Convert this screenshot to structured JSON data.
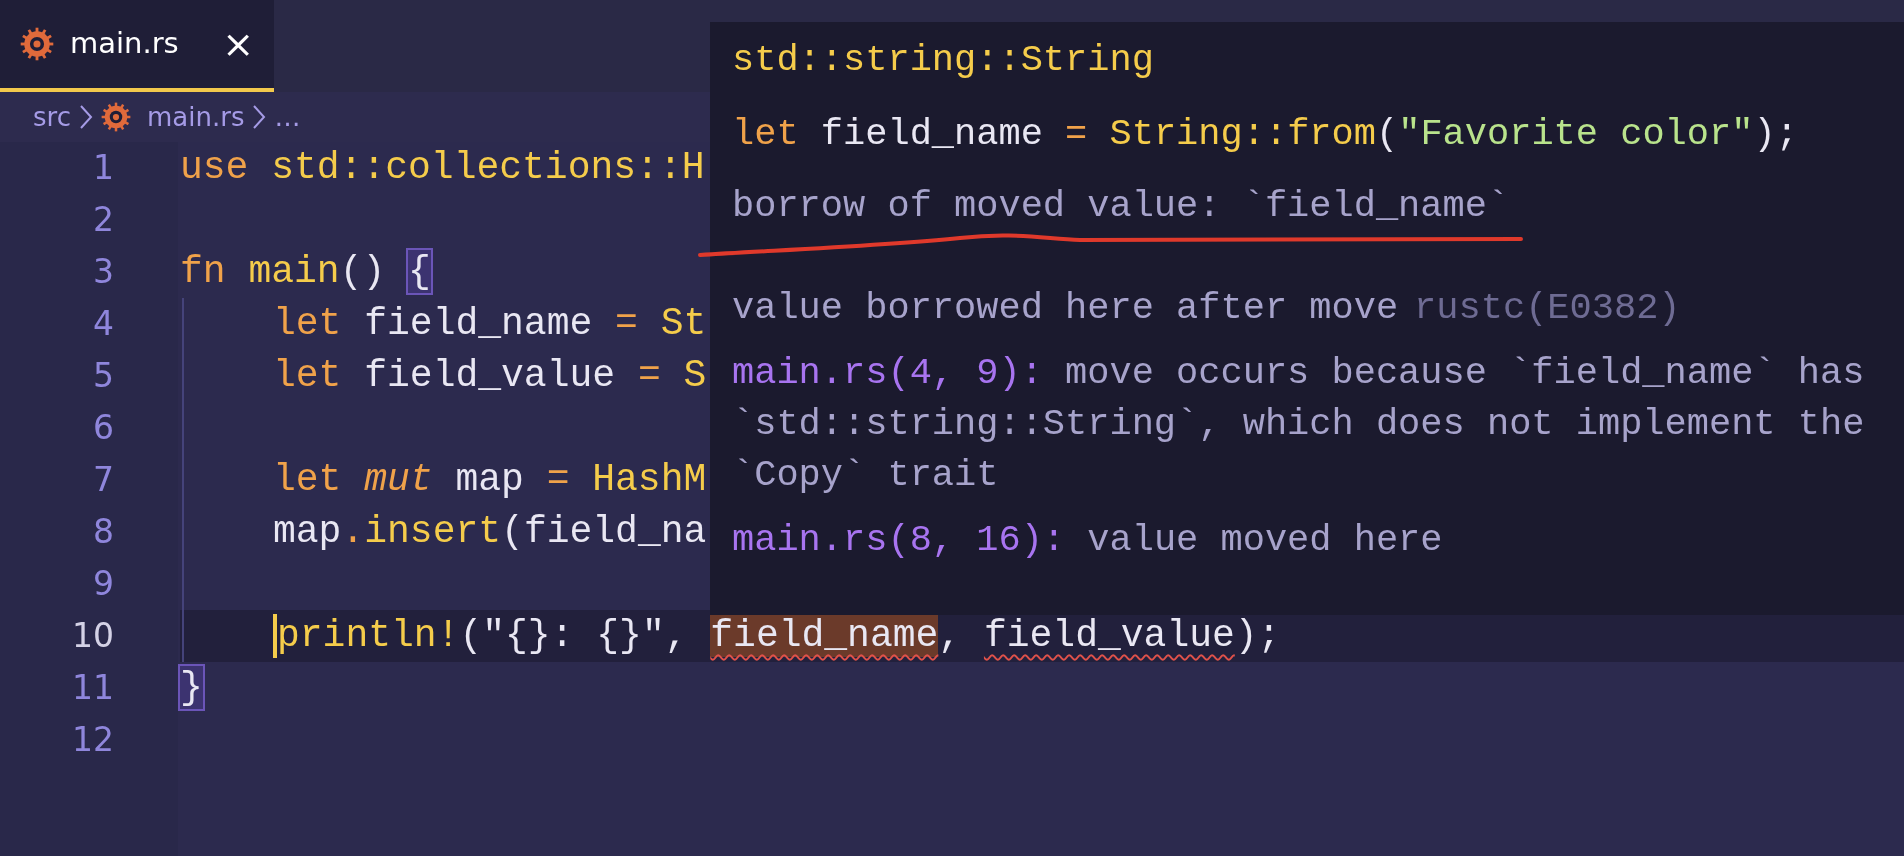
{
  "tabs": [
    {
      "label": "main.rs",
      "selected": true,
      "close": "×"
    }
  ],
  "breadcrumb": [
    {
      "label": "src",
      "icon": false
    },
    {
      "label": "main.rs",
      "icon": true
    },
    {
      "label": "…",
      "icon": false
    }
  ],
  "lines": [
    {
      "number": "1",
      "current": false,
      "indented": false,
      "tokens": [
        {
          "text": "use ",
          "kind": "keyword"
        },
        {
          "text": "std::collections::H",
          "kind": "type"
        }
      ]
    },
    {
      "number": "2",
      "current": false,
      "indented": false
    },
    {
      "number": "3",
      "current": false,
      "indented": false,
      "tokens": [
        {
          "text": "fn ",
          "kind": "keyword"
        },
        {
          "text": "main",
          "kind": "function"
        },
        {
          "text": "() ",
          "kind": "punct"
        },
        {
          "text": "{",
          "kind": "brace_match"
        }
      ]
    },
    {
      "number": "4",
      "current": false,
      "indented": true,
      "tokens": [
        {
          "text": "let ",
          "kind": "keyword"
        },
        {
          "text": "field_name ",
          "kind": "variable"
        },
        {
          "text": "= ",
          "kind": "operator"
        },
        {
          "text": "St",
          "kind": "type"
        }
      ]
    },
    {
      "number": "5",
      "current": false,
      "indented": true,
      "tokens": [
        {
          "text": "let ",
          "kind": "keyword"
        },
        {
          "text": "field_value ",
          "kind": "variable"
        },
        {
          "text": "= ",
          "kind": "operator"
        },
        {
          "text": "S",
          "kind": "type"
        }
      ]
    },
    {
      "number": "6",
      "current": false,
      "indented": true
    },
    {
      "number": "7",
      "current": false,
      "indented": true,
      "tokens": [
        {
          "text": "let ",
          "kind": "keyword"
        },
        {
          "text": "mut ",
          "kind": "keyword_italic"
        },
        {
          "text": "map ",
          "kind": "variable"
        },
        {
          "text": "= ",
          "kind": "operator"
        },
        {
          "text": "HashM",
          "kind": "type"
        }
      ]
    },
    {
      "number": "8",
      "current": false,
      "indented": true,
      "tokens": [
        {
          "text": "map",
          "kind": "variable"
        },
        {
          "text": ".",
          "kind": "operator"
        },
        {
          "text": "insert",
          "kind": "function"
        },
        {
          "text": "(",
          "kind": "punct"
        },
        {
          "text": "field_na",
          "kind": "variable"
        }
      ]
    },
    {
      "number": "9",
      "current": false,
      "indented": true
    },
    {
      "number": "10",
      "current": true,
      "indented": true,
      "tokens": [
        {
          "text": "println!",
          "kind": "function"
        },
        {
          "text": "(",
          "kind": "punct"
        },
        {
          "text": "\"{}: {}\"",
          "kind": "format"
        },
        {
          "text": ", ",
          "kind": "punct"
        },
        {
          "text": "field_name",
          "kind": "error_highlighted"
        },
        {
          "text": ", ",
          "kind": "punct"
        },
        {
          "text": "field_value",
          "kind": "error"
        },
        {
          "text": ");",
          "kind": "punct"
        }
      ]
    },
    {
      "number": "11",
      "current": false,
      "indented": false,
      "tokens": [
        {
          "text": "}",
          "kind": "brace_match"
        }
      ]
    },
    {
      "number": "12",
      "current": false,
      "indented": false
    }
  ],
  "hover": {
    "type_signature": "std::string::String",
    "code": [
      {
        "text": "let ",
        "kind": "keyword"
      },
      {
        "text": "field_name ",
        "kind": "variable"
      },
      {
        "text": "= ",
        "kind": "operator"
      },
      {
        "text": "String::from",
        "kind": "type"
      },
      {
        "text": "(",
        "kind": "punct"
      },
      {
        "text": "\"Favorite color\"",
        "kind": "string"
      },
      {
        "text": ");",
        "kind": "punct"
      }
    ],
    "message": "borrow of moved value: `field_name`",
    "detail": "value borrowed here after move",
    "source": "rustc(E0382)",
    "related": [
      {
        "location": "main.rs(4, 9):",
        "lines": [
          "move occurs because `field_name` has",
          "`std::string::String`, which does not implement the",
          "`Copy` trait"
        ]
      },
      {
        "location": "main.rs(8, 16):",
        "lines": [
          "value moved here"
        ]
      }
    ]
  }
}
